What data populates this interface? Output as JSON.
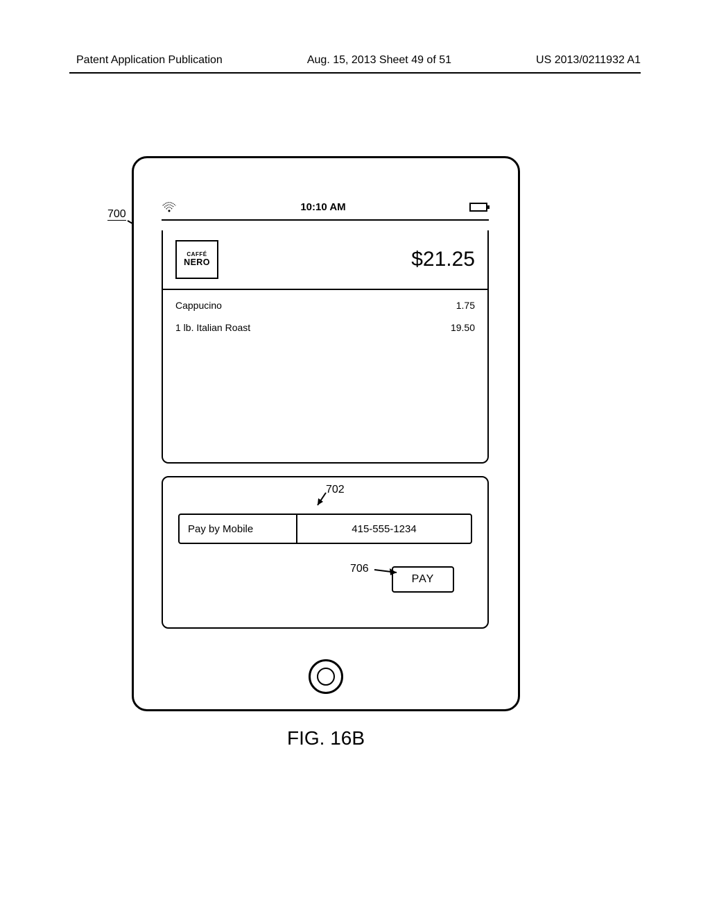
{
  "header": {
    "left": "Patent Application Publication",
    "center": "Aug. 15, 2013  Sheet 49 of 51",
    "right": "US 2013/0211932 A1"
  },
  "status": {
    "time": "10:10 AM"
  },
  "merchant": {
    "line1": "CAFFÉ",
    "line2": "NERO",
    "total": "$21.25"
  },
  "items": [
    {
      "name": "Cappucino",
      "price": "1.75"
    },
    {
      "name": "1 lb. Italian Roast",
      "price": "19.50"
    }
  ],
  "payment": {
    "method_label": "Pay by Mobile",
    "phone": "415-555-1234",
    "button": "PAY"
  },
  "refs": {
    "r700": "700",
    "r702": "702",
    "r706": "706"
  },
  "figure": "FIG. 16B"
}
